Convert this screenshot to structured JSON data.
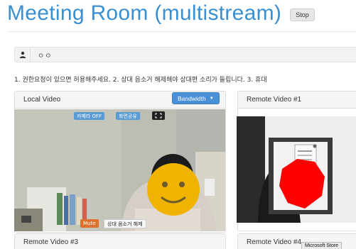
{
  "header": {
    "title": "Meeting Room (multistream)",
    "stop_label": "Stop"
  },
  "user": {
    "name": "ㅇㅇ",
    "icon": "user-icon"
  },
  "instructions": "1. 권한요청이 있으면 허용해주세요. 2. 상대 음소거 해제해야 상대편 소리가 들립니다. 3. 휴대",
  "local_panel": {
    "title": "Local Video",
    "bandwidth_label": "Bandwidth",
    "camera_off_label": "카메라 OFF",
    "screen_share_label": "화면공유",
    "fullscreen_icon": "expand-icon",
    "mute_label": "Mute",
    "unmute_remote_label": "상대 음소거 해제"
  },
  "remote_panels": {
    "r1": "Remote Video #1",
    "r3": "Remote Video #3",
    "r4": "Remote Video #4"
  },
  "taskbar_tooltip": "Microsoft Store",
  "colors": {
    "title": "#3a8fd0",
    "accent": "#4a90d9",
    "mute": "#e0712d"
  }
}
